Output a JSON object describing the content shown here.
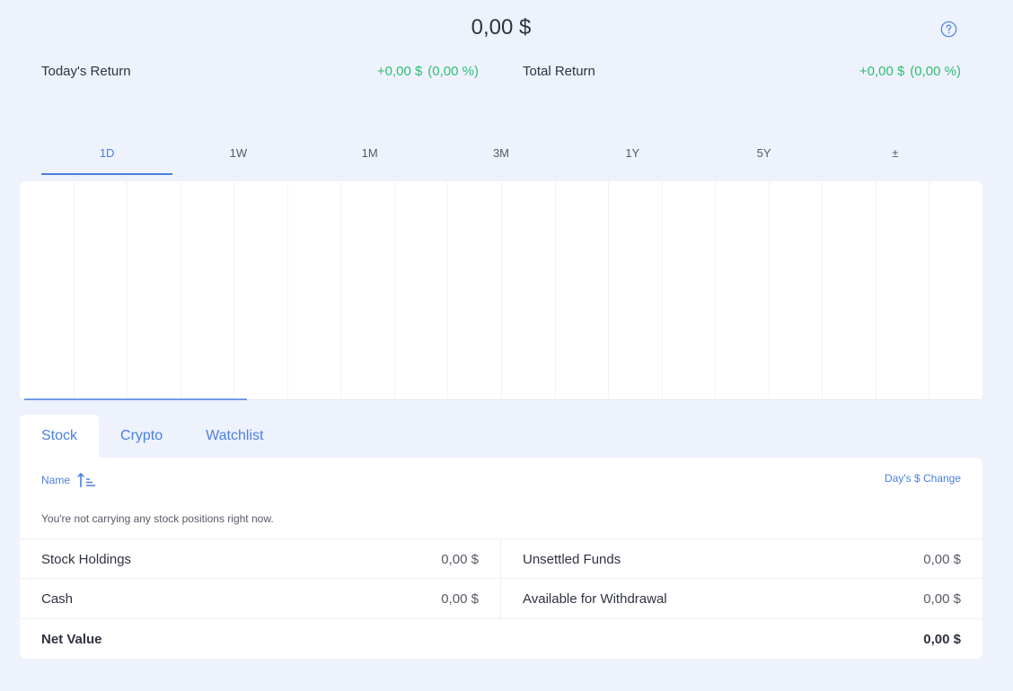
{
  "portfolio": {
    "total_value": "0,00 $"
  },
  "returns": {
    "today_label": "Today's Return",
    "today_value": "+0,00 $",
    "today_pct": "(0,00 %)",
    "total_label": "Total Return",
    "total_value": "+0,00 $",
    "total_pct": "(0,00 %)"
  },
  "time_tabs": [
    "1D",
    "1W",
    "1M",
    "3M",
    "1Y",
    "5Y",
    "±"
  ],
  "active_time_tab": "1D",
  "holdings_tabs": [
    "Stock",
    "Crypto",
    "Watchlist"
  ],
  "active_holdings_tab": "Stock",
  "table": {
    "name_header": "Name",
    "change_header": "Day's $ Change",
    "empty_message": "You're not carrying any stock positions right now."
  },
  "summary": {
    "stock_holdings_label": "Stock Holdings",
    "stock_holdings_value": "0,00 $",
    "unsettled_funds_label": "Unsettled Funds",
    "unsettled_funds_value": "0,00 $",
    "cash_label": "Cash",
    "cash_value": "0,00 $",
    "withdrawal_label": "Available for Withdrawal",
    "withdrawal_value": "0,00 $",
    "net_value_label": "Net Value",
    "net_value_value": "0,00 $"
  },
  "colors": {
    "accent": "#4a7fe0",
    "positive": "#2fbf71",
    "background": "#eef2fd",
    "card": "#ffffff"
  },
  "icons": {
    "help": "help-circle-icon",
    "sort": "sort-ascending-icon"
  }
}
